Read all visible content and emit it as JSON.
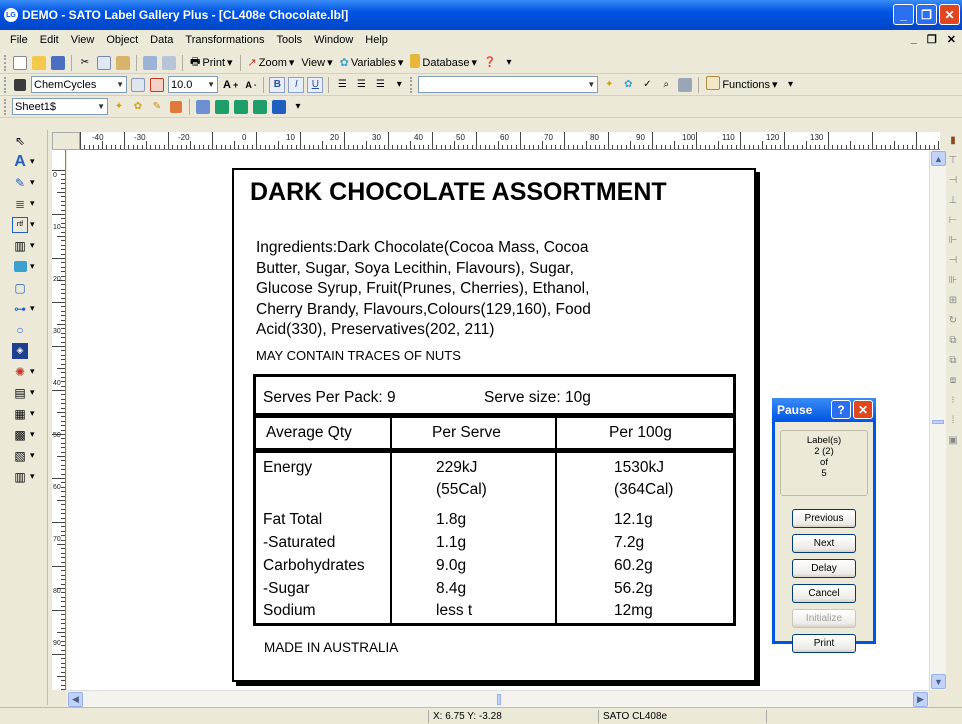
{
  "window": {
    "title": "DEMO - SATO Label Gallery Plus - [CL408e Chocolate.lbl]",
    "app_icon": "LG"
  },
  "menu": [
    "File",
    "Edit",
    "View",
    "Object",
    "Data",
    "Transformations",
    "Tools",
    "Window",
    "Help"
  ],
  "toolbar1": {
    "print": "Print",
    "zoom": "Zoom",
    "view": "View",
    "variables": "Variables",
    "database": "Database"
  },
  "toolbar2": {
    "font_name": "ChemCycles",
    "font_size": "10.0",
    "functions": "Functions"
  },
  "toolbar3": {
    "sheet": "Sheet1$"
  },
  "rulers": {
    "top_labels": [
      "-40",
      "-30",
      "-20",
      "0",
      "10",
      "20",
      "30",
      "40",
      "50",
      "60",
      "70",
      "80",
      "90",
      "100",
      "110",
      "120",
      "130"
    ],
    "left_labels": [
      "0",
      "10",
      "20",
      "30",
      "40",
      "50",
      "60",
      "70",
      "80",
      "90",
      "100"
    ]
  },
  "label": {
    "title": "DARK CHOCOLATE ASSORTMENT",
    "ingredients_lines": [
      "Ingredients:Dark Chocolate(Cocoa Mass, Cocoa",
      "Butter, Sugar, Soya Lecithin, Flavours), Sugar,",
      "Glucose Syrup, Fruit(Prunes, Cherries), Ethanol,",
      "Cherry Brandy, Flavours,Colours(129,160), Food",
      "Acid(330), Preservatives(202, 211)"
    ],
    "nuts_warning": "MAY CONTAIN TRACES OF NUTS",
    "serves_per_pack": "Serves Per Pack: 9",
    "serve_size": "Serve size:  10g",
    "headers": [
      "Average Qty",
      "Per Serve",
      "Per 100g"
    ],
    "rows": [
      {
        "name": "Energy",
        "serve": "229kJ",
        "per100": "1530kJ"
      },
      {
        "name": "",
        "serve": "(55Cal)",
        "per100": "(364Cal)"
      },
      {
        "name": "Fat Total",
        "serve": "1.8g",
        "per100": "12.1g"
      },
      {
        "name": "-Saturated",
        "serve": "1.1g",
        "per100": "7.2g"
      },
      {
        "name": "Carbohydrates",
        "serve": "9.0g",
        "per100": "60.2g"
      },
      {
        "name": "-Sugar",
        "serve": "8.4g",
        "per100": "56.2g"
      },
      {
        "name": "Sodium",
        "serve": "less t",
        "per100": "12mg"
      }
    ],
    "made_in": "MADE IN AUSTRALIA"
  },
  "pause_dialog": {
    "title": "Pause",
    "info_label": "Label(s)",
    "info_current": "2 (2)",
    "info_of": "of",
    "info_total": "5",
    "buttons": {
      "previous": "Previous",
      "next": "Next",
      "delay": "Delay",
      "cancel": "Cancel",
      "initialize": "Initialize",
      "print": "Print"
    }
  },
  "status": {
    "coords": "X: 6.75 Y: -3.28",
    "printer": "SATO CL408e"
  },
  "colors": {
    "titlebar": "#0054e3",
    "close": "#e0471f"
  }
}
